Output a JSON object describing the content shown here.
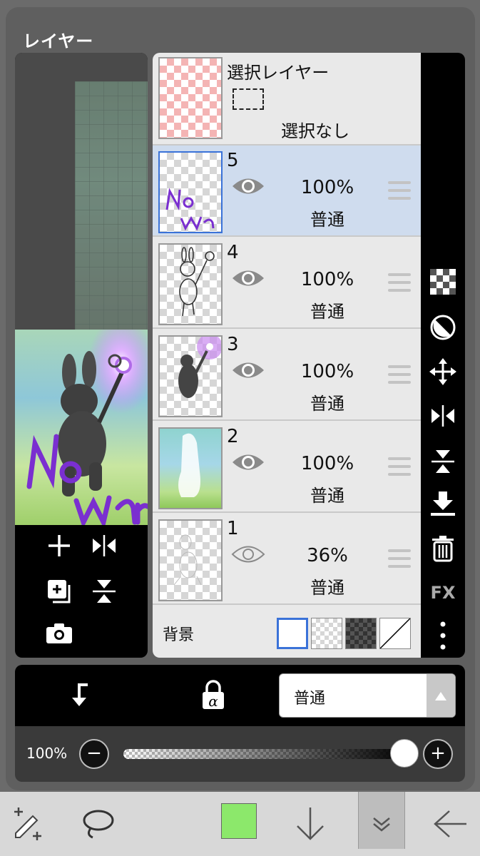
{
  "panel": {
    "title": "レイヤー"
  },
  "selection_layer": {
    "title": "選択レイヤー",
    "status": "選択なし"
  },
  "layers": [
    {
      "number": "5",
      "visible": true,
      "opacity": "100%",
      "mode": "普通",
      "selected": true
    },
    {
      "number": "4",
      "visible": true,
      "opacity": "100%",
      "mode": "普通",
      "selected": false
    },
    {
      "number": "3",
      "visible": true,
      "opacity": "100%",
      "mode": "普通",
      "selected": false
    },
    {
      "number": "2",
      "visible": true,
      "opacity": "100%",
      "mode": "普通",
      "selected": false
    },
    {
      "number": "1",
      "visible": false,
      "opacity": "36%",
      "mode": "普通",
      "selected": false
    }
  ],
  "background": {
    "label": "背景",
    "options": [
      "white",
      "transparent",
      "dark-checker",
      "none"
    ],
    "selected": "white"
  },
  "preview_tools": [
    "add-layer-icon",
    "flip-horizontal-icon",
    "duplicate-layer-icon",
    "flip-vertical-icon",
    "camera-icon"
  ],
  "right_toolbar": [
    "checker-icon",
    "contrast-icon",
    "move-icon",
    "flip-horizontal-icon",
    "flip-vertical-icon",
    "merge-down-icon",
    "trash-icon",
    "fx-icon",
    "more-icon"
  ],
  "right_toolbar_fx": "FX",
  "blend": {
    "clip_icon": "clipping-arrow-icon",
    "alpha_lock_icon": "alpha-lock-icon",
    "mode": "普通"
  },
  "opacity_bar": {
    "label": "100%",
    "value": 1.0
  },
  "bottom_toolbar": {
    "brush_color": "#8ce86b",
    "icons": [
      "transform-icon",
      "lasso-icon",
      "color-swatch",
      "down-arrow-icon",
      "collapse-icon",
      "back-arrow-icon"
    ]
  }
}
